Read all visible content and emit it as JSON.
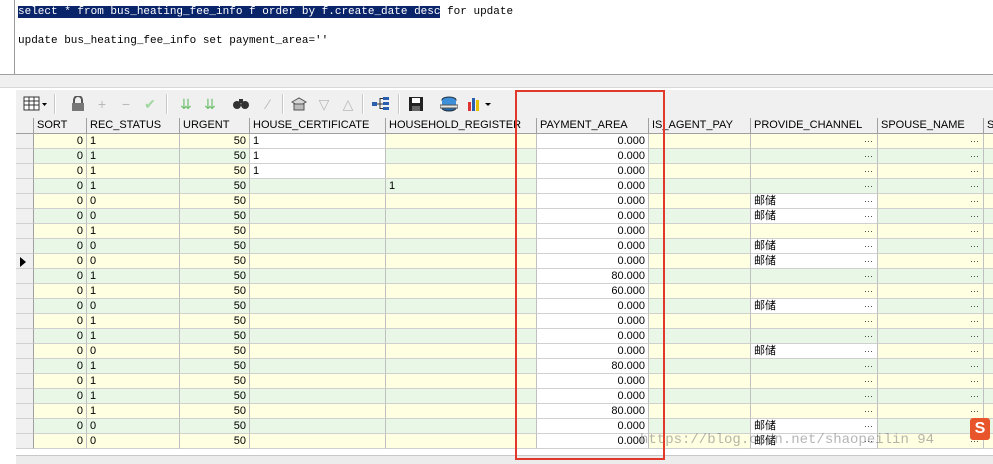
{
  "editor": {
    "line1_selected": "select * from bus_heating_fee_info f order by f.create_date desc",
    "line1_rest": " for update",
    "line2": "update bus_heating_fee_info set payment_area=''"
  },
  "toolbar": {
    "icons": [
      "grid-view-icon",
      "lock-icon",
      "add-record-icon",
      "delete-record-icon",
      "post-changes-icon",
      "next-record-icon",
      "last-record-icon",
      "find-icon",
      "clear-icon",
      "query-by-example-icon",
      "sort-desc-icon",
      "sort-asc-icon",
      "link-icon",
      "save-icon",
      "export-icon",
      "chart-icon"
    ]
  },
  "columns": [
    "SORT",
    "REC_STATUS",
    "URGENT",
    "HOUSE_CERTIFICATE",
    "HOUSEHOLD_REGISTER",
    "PAYMENT_AREA",
    "IS_AGENT_PAY",
    "PROVIDE_CHANNEL",
    "SPOUSE_NAME",
    "S"
  ],
  "rows": [
    {
      "sort": "0",
      "rec_status": "1",
      "urgent": "50",
      "house_certificate": "1",
      "household_register": "",
      "payment_area": "0.000",
      "provide_channel": ""
    },
    {
      "sort": "0",
      "rec_status": "1",
      "urgent": "50",
      "house_certificate": "1",
      "household_register": "",
      "payment_area": "0.000",
      "provide_channel": ""
    },
    {
      "sort": "0",
      "rec_status": "1",
      "urgent": "50",
      "house_certificate": "1",
      "household_register": "",
      "payment_area": "0.000",
      "provide_channel": ""
    },
    {
      "sort": "0",
      "rec_status": "1",
      "urgent": "50",
      "house_certificate": "",
      "household_register": "1",
      "payment_area": "0.000",
      "provide_channel": ""
    },
    {
      "sort": "0",
      "rec_status": "0",
      "urgent": "50",
      "house_certificate": "",
      "household_register": "",
      "payment_area": "0.000",
      "provide_channel": "邮储"
    },
    {
      "sort": "0",
      "rec_status": "0",
      "urgent": "50",
      "house_certificate": "",
      "household_register": "",
      "payment_area": "0.000",
      "provide_channel": "邮储"
    },
    {
      "sort": "0",
      "rec_status": "1",
      "urgent": "50",
      "house_certificate": "",
      "household_register": "",
      "payment_area": "0.000",
      "provide_channel": ""
    },
    {
      "sort": "0",
      "rec_status": "0",
      "urgent": "50",
      "house_certificate": "",
      "household_register": "",
      "payment_area": "0.000",
      "provide_channel": "邮储"
    },
    {
      "sort": "0",
      "rec_status": "0",
      "urgent": "50",
      "house_certificate": "",
      "household_register": "",
      "payment_area": "0.000",
      "provide_channel": "邮储"
    },
    {
      "sort": "0",
      "rec_status": "1",
      "urgent": "50",
      "house_certificate": "",
      "household_register": "",
      "payment_area": "80.000",
      "provide_channel": ""
    },
    {
      "sort": "0",
      "rec_status": "1",
      "urgent": "50",
      "house_certificate": "",
      "household_register": "",
      "payment_area": "60.000",
      "provide_channel": ""
    },
    {
      "sort": "0",
      "rec_status": "0",
      "urgent": "50",
      "house_certificate": "",
      "household_register": "",
      "payment_area": "0.000",
      "provide_channel": "邮储"
    },
    {
      "sort": "0",
      "rec_status": "1",
      "urgent": "50",
      "house_certificate": "",
      "household_register": "",
      "payment_area": "0.000",
      "provide_channel": ""
    },
    {
      "sort": "0",
      "rec_status": "1",
      "urgent": "50",
      "house_certificate": "",
      "household_register": "",
      "payment_area": "0.000",
      "provide_channel": ""
    },
    {
      "sort": "0",
      "rec_status": "0",
      "urgent": "50",
      "house_certificate": "",
      "household_register": "",
      "payment_area": "0.000",
      "provide_channel": "邮储"
    },
    {
      "sort": "0",
      "rec_status": "1",
      "urgent": "50",
      "house_certificate": "",
      "household_register": "",
      "payment_area": "80.000",
      "provide_channel": ""
    },
    {
      "sort": "0",
      "rec_status": "1",
      "urgent": "50",
      "house_certificate": "",
      "household_register": "",
      "payment_area": "0.000",
      "provide_channel": ""
    },
    {
      "sort": "0",
      "rec_status": "1",
      "urgent": "50",
      "house_certificate": "",
      "household_register": "",
      "payment_area": "0.000",
      "provide_channel": ""
    },
    {
      "sort": "0",
      "rec_status": "1",
      "urgent": "50",
      "house_certificate": "",
      "household_register": "",
      "payment_area": "80.000",
      "provide_channel": ""
    },
    {
      "sort": "0",
      "rec_status": "0",
      "urgent": "50",
      "house_certificate": "",
      "household_register": "",
      "payment_area": "0.000",
      "provide_channel": "邮储"
    },
    {
      "sort": "0",
      "rec_status": "0",
      "urgent": "50",
      "house_certificate": "",
      "household_register": "",
      "payment_area": "0.000",
      "provide_channel": "邮储"
    }
  ],
  "current_row_index": 8,
  "watermark": "https://blog.csdn.net/shaopeilin 94",
  "logo_letter": "S",
  "colors": {
    "selection": "#0a246a",
    "highlight_box": "#e0392b",
    "row_yellow": "#ffffe1",
    "row_green": "#e8f7e6"
  }
}
